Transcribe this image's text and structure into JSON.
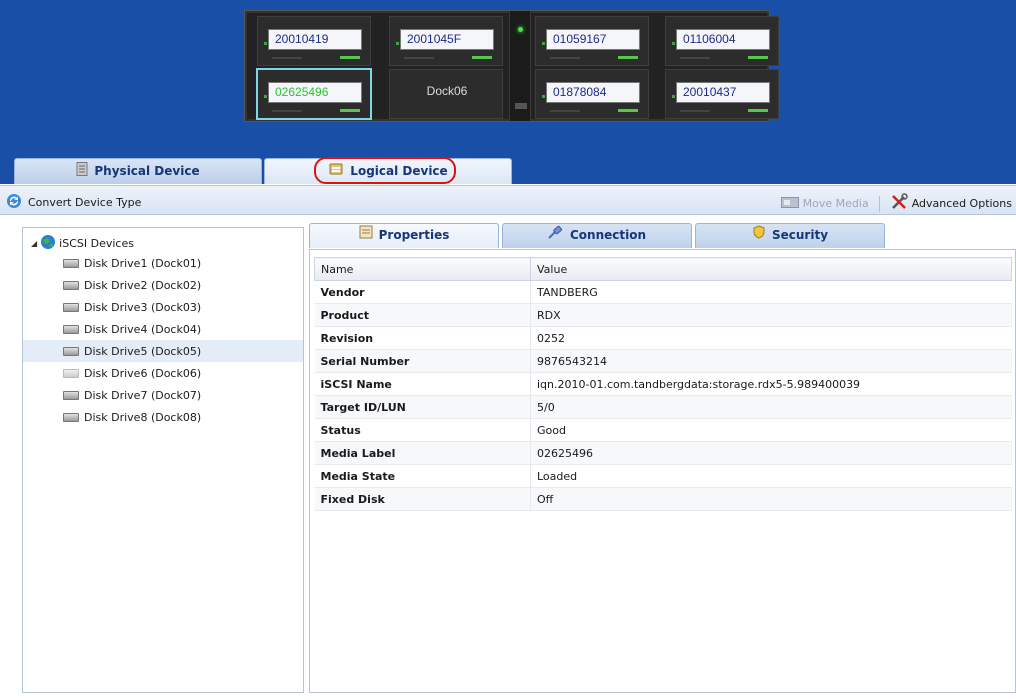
{
  "bays": [
    {
      "label": "20010419"
    },
    {
      "label": "2001045F"
    },
    {
      "label": "01059167"
    },
    {
      "label": "01106004"
    },
    {
      "label": "02625496"
    },
    {
      "label": "Dock06"
    },
    {
      "label": "01878084"
    },
    {
      "label": "20010437"
    }
  ],
  "main_tabs": {
    "physical": "Physical Device",
    "logical": "Logical Device"
  },
  "toolbar": {
    "convert": "Convert Device Type",
    "move_media": "Move Media",
    "advanced": "Advanced Options"
  },
  "tree": {
    "root": "iSCSI Devices",
    "items": [
      {
        "label": "Disk Drive1 (Dock01)"
      },
      {
        "label": "Disk Drive2 (Dock02)"
      },
      {
        "label": "Disk Drive3 (Dock03)"
      },
      {
        "label": "Disk Drive4 (Dock04)"
      },
      {
        "label": "Disk Drive5 (Dock05)"
      },
      {
        "label": "Disk Drive6 (Dock06)"
      },
      {
        "label": "Disk Drive7 (Dock07)"
      },
      {
        "label": "Disk Drive8 (Dock08)"
      }
    ],
    "selected_index": 4
  },
  "sub_tabs": {
    "properties": "Properties",
    "connection": "Connection",
    "security": "Security"
  },
  "table": {
    "headers": [
      "Name",
      "Value"
    ],
    "rows": [
      {
        "name": "Vendor",
        "value": "TANDBERG"
      },
      {
        "name": "Product",
        "value": "RDX"
      },
      {
        "name": "Revision",
        "value": "0252"
      },
      {
        "name": "Serial Number",
        "value": "9876543214"
      },
      {
        "name": "iSCSI Name",
        "value": "iqn.2010-01.com.tandbergdata:storage.rdx5-5.989400039"
      },
      {
        "name": "Target ID/LUN",
        "value": "5/0"
      },
      {
        "name": "Status",
        "value": "Good"
      },
      {
        "name": "Media Label",
        "value": "02625496"
      },
      {
        "name": "Media State",
        "value": "Loaded"
      },
      {
        "name": "Fixed Disk",
        "value": "Off"
      }
    ]
  },
  "colors": {
    "header_blue": "#1a4fa8",
    "accent_red": "#e01010",
    "led_green": "#4ce04c"
  }
}
